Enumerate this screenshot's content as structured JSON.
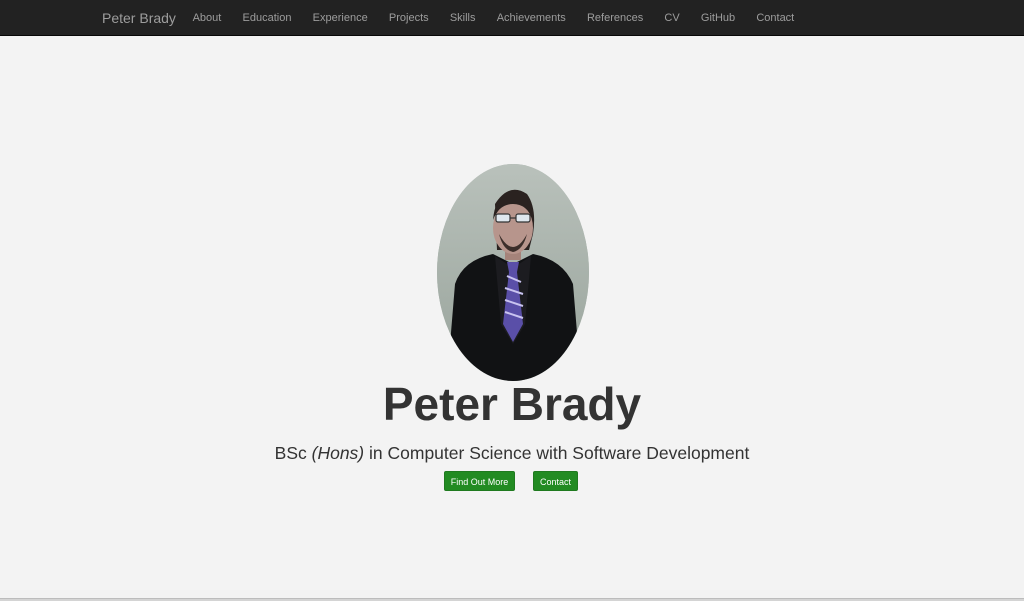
{
  "navbar": {
    "brand": "Peter Brady",
    "links": [
      {
        "label": "About"
      },
      {
        "label": "Education"
      },
      {
        "label": "Experience"
      },
      {
        "label": "Projects"
      },
      {
        "label": "Skills"
      },
      {
        "label": "Achievements"
      },
      {
        "label": "References"
      },
      {
        "label": "CV"
      },
      {
        "label": "GitHub"
      },
      {
        "label": "Contact"
      }
    ]
  },
  "hero": {
    "name": "Peter Brady",
    "degree_prefix": "BSc",
    "degree_hons": "(Hons)",
    "degree_suffix": "in Computer Science with Software Development",
    "buttons": {
      "find_out_more": "Find Out More",
      "contact": "Contact"
    }
  },
  "colors": {
    "navbar_bg": "#222222",
    "nav_text": "#9d9d9d",
    "page_bg": "#f3f3f3",
    "heading_text": "#333333",
    "button_bg": "#228b22",
    "button_text": "#ffffff"
  }
}
